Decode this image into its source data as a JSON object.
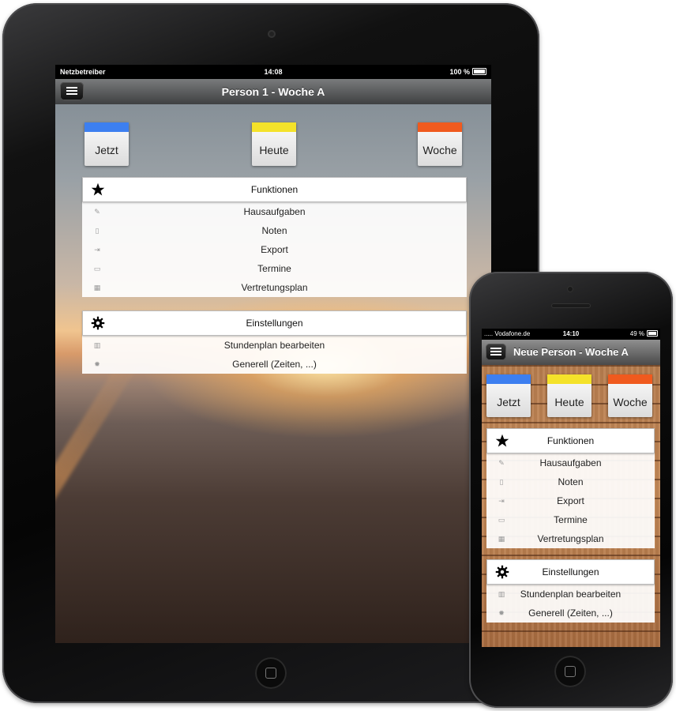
{
  "ipad": {
    "status": {
      "carrier": "Netzbetreiber",
      "time": "14:08",
      "battery": "100 %"
    },
    "nav": {
      "title": "Person 1 - Woche A"
    },
    "calendars": [
      {
        "label": "Jetzt",
        "color": "#3d7ff0"
      },
      {
        "label": "Heute",
        "color": "#f4e22a"
      },
      {
        "label": "Woche",
        "color": "#f05a1e"
      }
    ],
    "funktionen": {
      "header": "Funktionen",
      "items": [
        "Hausaufgaben",
        "Noten",
        "Export",
        "Termine",
        "Vertretungsplan"
      ]
    },
    "einstellungen": {
      "header": "Einstellungen",
      "items": [
        "Stundenplan bearbeiten",
        "Generell (Zeiten, ...)"
      ]
    }
  },
  "iphone": {
    "status": {
      "carrier": "..... Vodafone.de",
      "time": "14:10",
      "battery": "49 %"
    },
    "nav": {
      "title": "Neue Person - Woche A"
    },
    "calendars": [
      {
        "label": "Jetzt",
        "color": "#3d7ff0"
      },
      {
        "label": "Heute",
        "color": "#f4e22a"
      },
      {
        "label": "Woche",
        "color": "#f05a1e"
      }
    ],
    "funktionen": {
      "header": "Funktionen",
      "items": [
        "Hausaufgaben",
        "Noten",
        "Export",
        "Termine",
        "Vertretungsplan"
      ]
    },
    "einstellungen": {
      "header": "Einstellungen",
      "items": [
        "Stundenplan bearbeiten",
        "Generell (Zeiten, ...)"
      ]
    }
  },
  "icons": {
    "funktionen_items": [
      "homework-icon",
      "grades-icon",
      "export-icon",
      "calendar-icon",
      "substitution-plan-icon"
    ],
    "einstellungen_items": [
      "timetable-icon",
      "gear-icon"
    ]
  }
}
